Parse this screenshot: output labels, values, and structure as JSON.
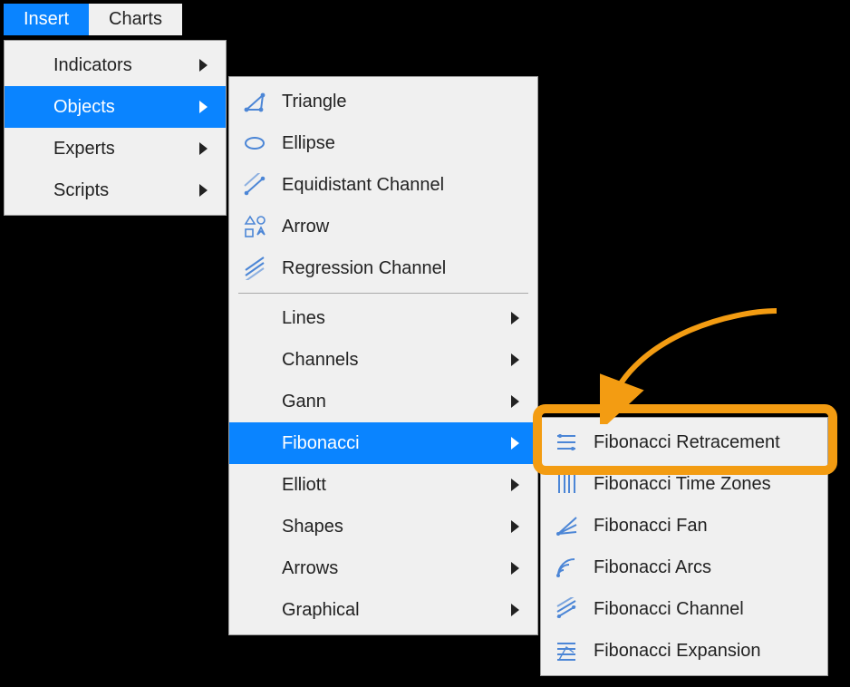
{
  "colors": {
    "accent": "#0a84ff",
    "icon": "#4c86d6",
    "callout": "#f39c12"
  },
  "menubar": [
    {
      "label": "Insert",
      "active": true
    },
    {
      "label": "Charts",
      "active": false
    }
  ],
  "insert_menu": [
    {
      "label": "Indicators",
      "submenu": true,
      "highlight": false
    },
    {
      "label": "Objects",
      "submenu": true,
      "highlight": true
    },
    {
      "label": "Experts",
      "submenu": true,
      "highlight": false
    },
    {
      "label": "Scripts",
      "submenu": true,
      "highlight": false
    }
  ],
  "objects_menu": {
    "group1": [
      {
        "icon": "triangle-icon",
        "label": "Triangle"
      },
      {
        "icon": "ellipse-icon",
        "label": "Ellipse"
      },
      {
        "icon": "channel-icon",
        "label": "Equidistant Channel"
      },
      {
        "icon": "arrow-shapes-icon",
        "label": "Arrow"
      },
      {
        "icon": "regression-icon",
        "label": "Regression Channel"
      }
    ],
    "group2": [
      {
        "label": "Lines",
        "submenu": true,
        "highlight": false
      },
      {
        "label": "Channels",
        "submenu": true,
        "highlight": false
      },
      {
        "label": "Gann",
        "submenu": true,
        "highlight": false
      },
      {
        "label": "Fibonacci",
        "submenu": true,
        "highlight": true
      },
      {
        "label": "Elliott",
        "submenu": true,
        "highlight": false
      },
      {
        "label": "Shapes",
        "submenu": true,
        "highlight": false
      },
      {
        "label": "Arrows",
        "submenu": true,
        "highlight": false
      },
      {
        "label": "Graphical",
        "submenu": true,
        "highlight": false
      }
    ]
  },
  "fibonacci_menu": [
    {
      "icon": "fib-retracement-icon",
      "label": "Fibonacci Retracement"
    },
    {
      "icon": "fib-timezones-icon",
      "label": "Fibonacci Time Zones"
    },
    {
      "icon": "fib-fan-icon",
      "label": "Fibonacci Fan"
    },
    {
      "icon": "fib-arcs-icon",
      "label": "Fibonacci Arcs"
    },
    {
      "icon": "fib-channel-icon",
      "label": "Fibonacci Channel"
    },
    {
      "icon": "fib-expansion-icon",
      "label": "Fibonacci Expansion"
    }
  ]
}
